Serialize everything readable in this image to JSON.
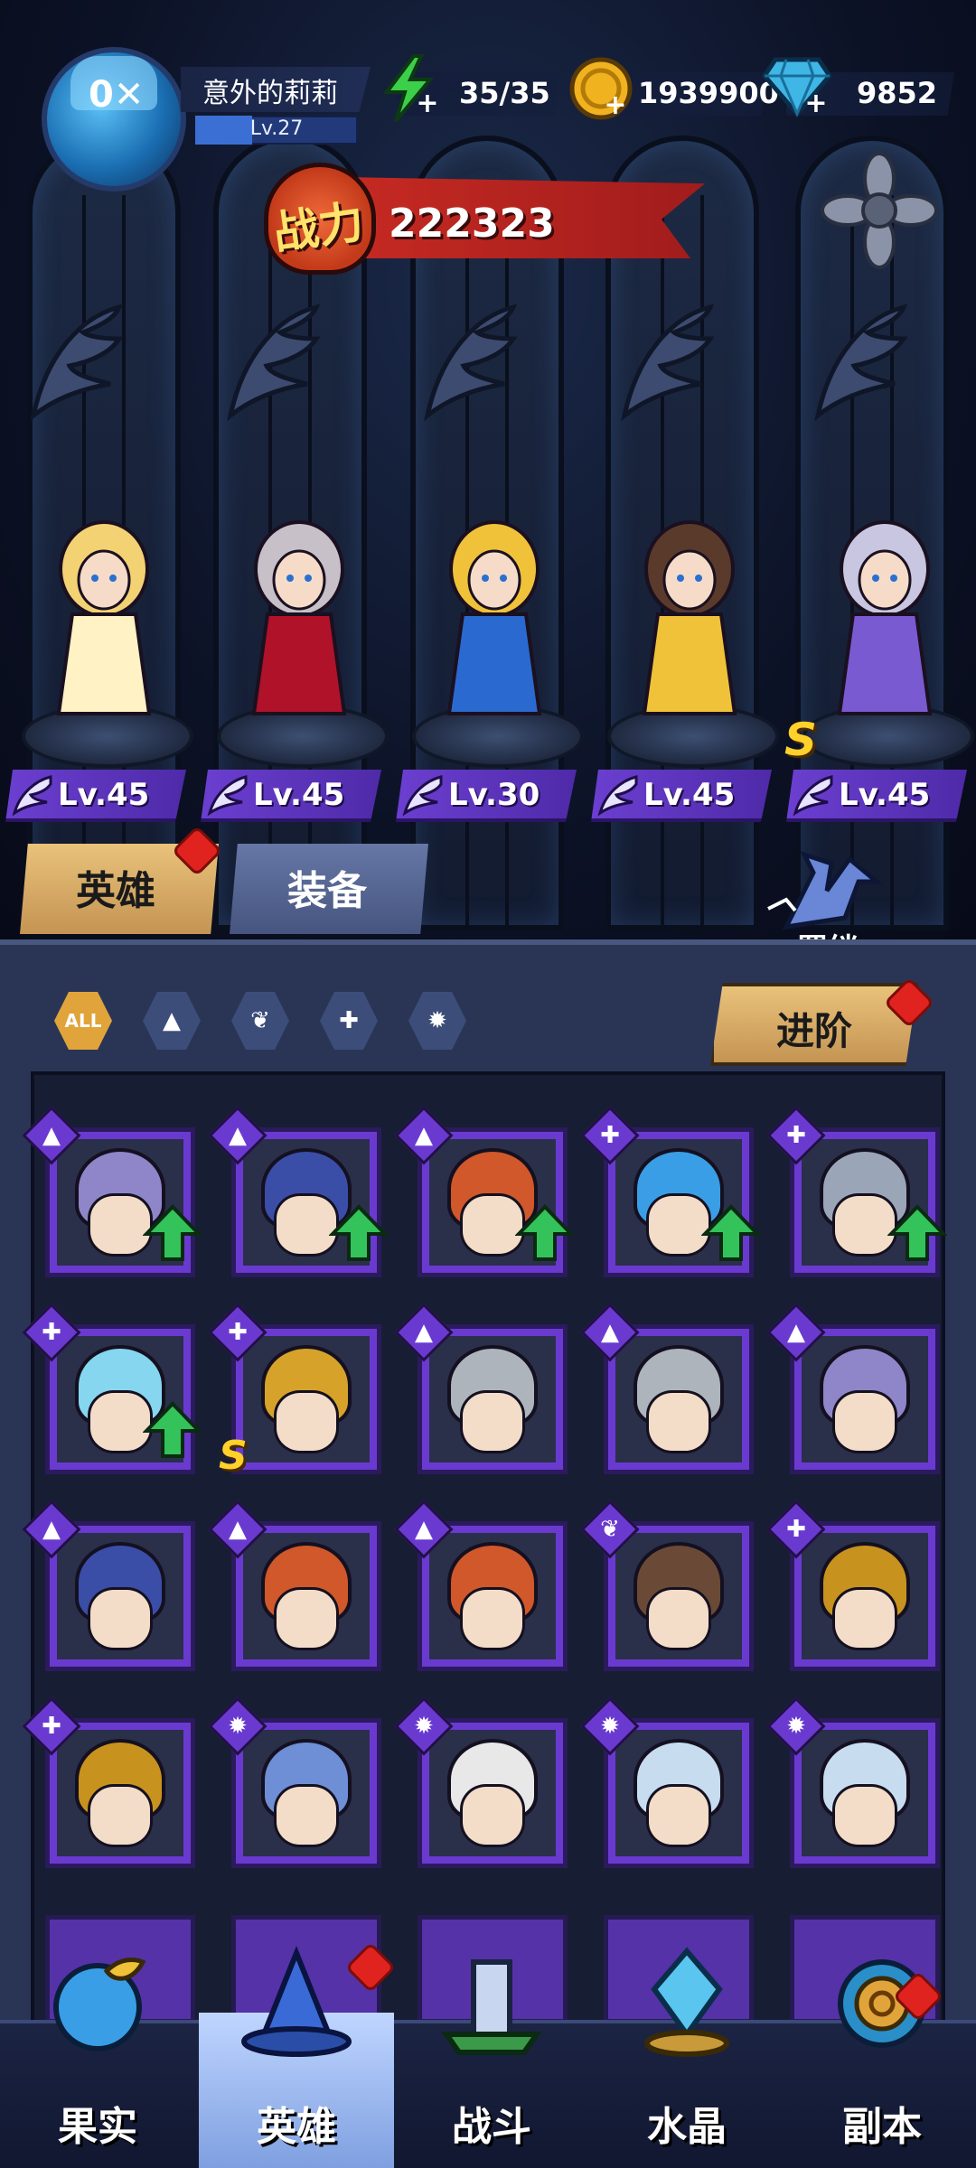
{
  "player": {
    "name": "意外的莉莉",
    "level": "Lv.27",
    "avatar_text": "0✕",
    "level_progress": 0.35
  },
  "resources": {
    "energy": "35/35",
    "gold": "1939900",
    "gems": "9852"
  },
  "power": {
    "label": "战力",
    "value": "222323"
  },
  "heroes": [
    {
      "level": "Lv.45",
      "name_icon": "angel-archer-hero"
    },
    {
      "level": "Lv.45",
      "name_icon": "vampire-lady-hero"
    },
    {
      "level": "Lv.30",
      "name_icon": "pharaoh-queen-hero"
    },
    {
      "level": "Lv.45",
      "name_icon": "golden-goddess-hero"
    },
    {
      "level": "Lv.45",
      "name_icon": "clock-mage-hero"
    }
  ],
  "hero_rank_badge": "S",
  "tabs": {
    "hero": "英雄",
    "equipment": "装备",
    "bond": "羁绊"
  },
  "filters": {
    "all": "ALL",
    "items": [
      "mage-filter-icon",
      "wing-filter-icon",
      "wrench-filter-icon",
      "beast-filter-icon"
    ]
  },
  "advance_button": "进阶",
  "grid": {
    "rows": [
      [
        {
          "class": "mage",
          "art": "bandaged-nun",
          "upgrade": true
        },
        {
          "class": "mage",
          "art": "brain-wizard",
          "upgrade": true
        },
        {
          "class": "mage",
          "art": "fire-mage",
          "upgrade": true
        },
        {
          "class": "wrench",
          "art": "glass-helmet-bot",
          "upgrade": true
        },
        {
          "class": "wrench",
          "art": "cube-robot",
          "upgrade": true
        }
      ],
      [
        {
          "class": "wrench",
          "art": "ghost-diver",
          "upgrade": true
        },
        {
          "class": "wrench",
          "art": "gold-robot",
          "upgrade": false,
          "rank": "S"
        },
        {
          "class": "mage",
          "art": "iron-knight",
          "upgrade": false
        },
        {
          "class": "mage",
          "art": "iron-knight-2",
          "upgrade": false
        },
        {
          "class": "mage",
          "art": "bandaged-nun-2",
          "upgrade": false
        }
      ],
      [
        {
          "class": "mage",
          "art": "brain-wizard-2",
          "upgrade": false
        },
        {
          "class": "mage",
          "art": "fire-mage-2",
          "upgrade": false
        },
        {
          "class": "mage",
          "art": "fire-mage-3",
          "upgrade": false
        },
        {
          "class": "wing",
          "art": "goddess",
          "upgrade": false
        },
        {
          "class": "wrench",
          "art": "red-eye-robot",
          "upgrade": false
        }
      ],
      [
        {
          "class": "wrench",
          "art": "red-eye-robot-2",
          "upgrade": false
        },
        {
          "class": "beast",
          "art": "blue-dragon",
          "upgrade": false
        },
        {
          "class": "beast",
          "art": "panda-warrior",
          "upgrade": false
        },
        {
          "class": "beast",
          "art": "white-bear",
          "upgrade": false
        },
        {
          "class": "beast",
          "art": "white-bear-2",
          "upgrade": false
        }
      ]
    ]
  },
  "nav": [
    {
      "label": "果实",
      "icon": "fruit-icon"
    },
    {
      "label": "英雄",
      "icon": "hero-hat-icon",
      "active": true
    },
    {
      "label": "战斗",
      "icon": "battle-icon"
    },
    {
      "label": "水晶",
      "icon": "crystal-icon"
    },
    {
      "label": "副本",
      "icon": "dungeon-icon"
    }
  ],
  "colors": {
    "card_purple": "#6a3ad0",
    "gold_tab": "#e9c27a",
    "red_badge": "#e0231f",
    "upgrade_green": "#34c25a"
  }
}
